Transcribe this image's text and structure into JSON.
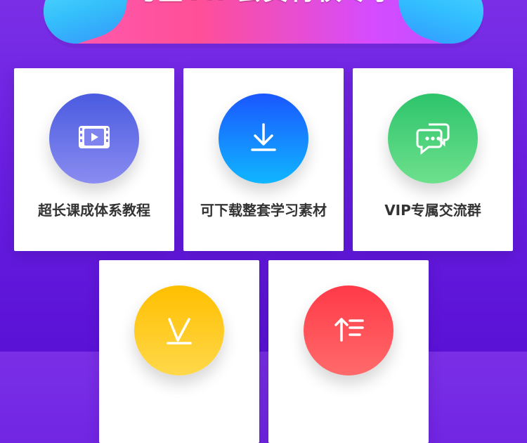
{
  "banner": {
    "title": "巧匠VIP会员特权专享"
  },
  "features": [
    {
      "label": "超长课成体系教程",
      "icon": "video-icon",
      "gradient": [
        "#4a5be0",
        "#8a8cf0"
      ]
    },
    {
      "label": "可下载整套学习素材",
      "icon": "download-icon",
      "gradient": [
        "#1a57ff",
        "#10b6ff"
      ]
    },
    {
      "label": "VIP专属交流群",
      "icon": "chat-bubbles-icon",
      "gradient": [
        "#2dc46b",
        "#6ee08d"
      ]
    },
    {
      "label": "",
      "icon": "checkmark-v-icon",
      "gradient": [
        "#ffbf00",
        "#ffd84a"
      ]
    },
    {
      "label": "",
      "icon": "list-upload-icon",
      "gradient": [
        "#ff3a48",
        "#ff6a6a"
      ]
    }
  ]
}
